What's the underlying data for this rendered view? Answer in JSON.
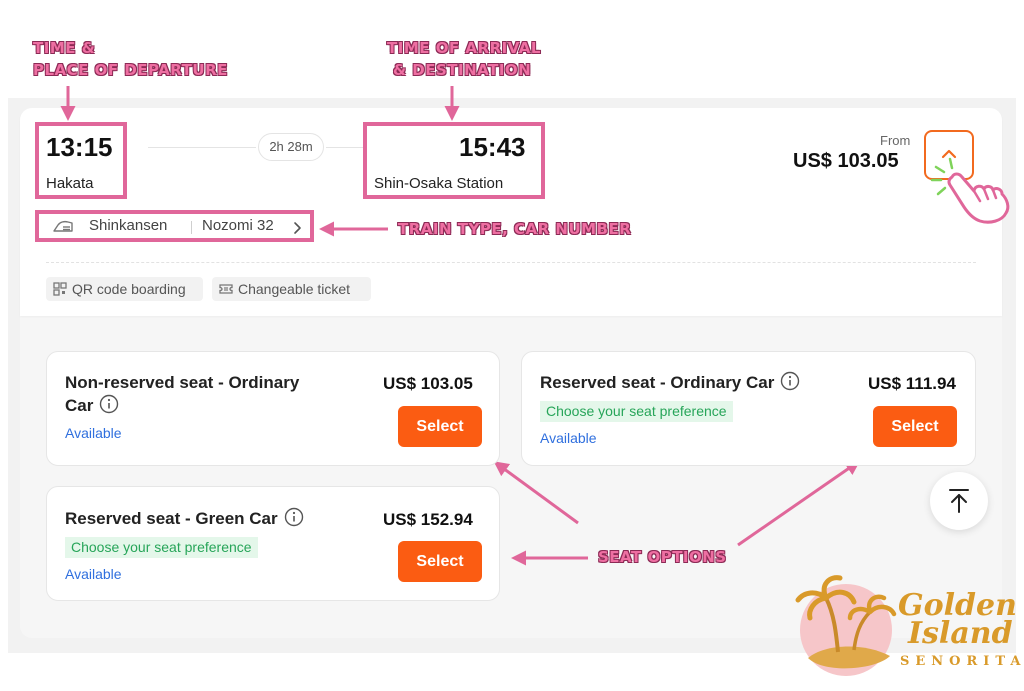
{
  "annotations": {
    "departure_line1": "TIME &",
    "departure_line2": "PLACE OF DEPARTURE",
    "arrival_line1": "TIME OF ARRIVAL",
    "arrival_line2": "& DESTINATION",
    "train_type": "TRAIN TYPE, CAR NUMBER",
    "seat_options": "SEAT OPTIONS"
  },
  "journey": {
    "departure_time": "13:15",
    "departure_station": "Hakata",
    "duration": "2h 28m",
    "arrival_time": "15:43",
    "arrival_station": "Shin-Osaka Station",
    "from_label": "From",
    "price": "US$ 103.05",
    "train_category": "Shinkansen",
    "train_name": "Nozomi 32"
  },
  "tags": [
    {
      "label": "QR code boarding",
      "icon": "qr-code-icon"
    },
    {
      "label": "Changeable ticket",
      "icon": "ticket-icon"
    }
  ],
  "seats": [
    {
      "title_line1": "Non-reserved seat - Ordinary",
      "title_line2": "Car",
      "price": "US$ 103.05",
      "availability": "Available",
      "select_label": "Select"
    },
    {
      "title": "Reserved seat - Ordinary Car",
      "price": "US$ 111.94",
      "preference": "Choose your seat preference",
      "availability": "Available",
      "select_label": "Select"
    },
    {
      "title": "Reserved seat - Green Car",
      "price": "US$ 152.94",
      "preference": "Choose your seat preference",
      "availability": "Available",
      "select_label": "Select"
    }
  ],
  "logo": {
    "line1": "Golden",
    "line2": "Island",
    "line3": "SENORITA"
  },
  "colors": {
    "accent_orange": "#fb5c12",
    "annotation_pink": "#e0679a",
    "available_blue": "#2f6fde",
    "preference_green": "#27a559"
  }
}
